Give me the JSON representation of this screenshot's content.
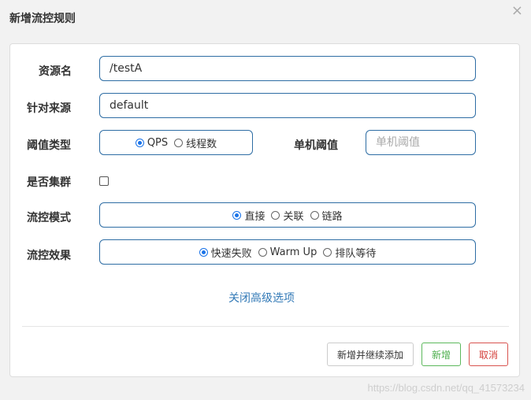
{
  "dialog": {
    "title": "新增流控规则",
    "close_icon": "×"
  },
  "form": {
    "resource": {
      "label": "资源名",
      "value": "/testA"
    },
    "limit_app": {
      "label": "针对来源",
      "value": "default"
    },
    "grade": {
      "label": "阈值类型",
      "options": [
        "QPS",
        "线程数"
      ],
      "selected": "QPS"
    },
    "threshold": {
      "label": "单机阈值",
      "placeholder": "单机阈值",
      "value": ""
    },
    "cluster": {
      "label": "是否集群",
      "checked": false
    },
    "strategy": {
      "label": "流控模式",
      "options": [
        "直接",
        "关联",
        "链路"
      ],
      "selected": "直接"
    },
    "control_behavior": {
      "label": "流控效果",
      "options": [
        "快速失败",
        "Warm Up",
        "排队等待"
      ],
      "selected": "快速失败"
    },
    "advanced_link": "关闭高级选项"
  },
  "footer": {
    "add_continue_label": "新增并继续添加",
    "add_label": "新增",
    "cancel_label": "取消"
  },
  "watermark": "https://blog.csdn.net/qq_41573234",
  "colors": {
    "input_border": "#2e6da4",
    "radio_checked": "#1a73e8",
    "link": "#337ab7",
    "success": "#5cb85c",
    "danger": "#d9534f"
  }
}
